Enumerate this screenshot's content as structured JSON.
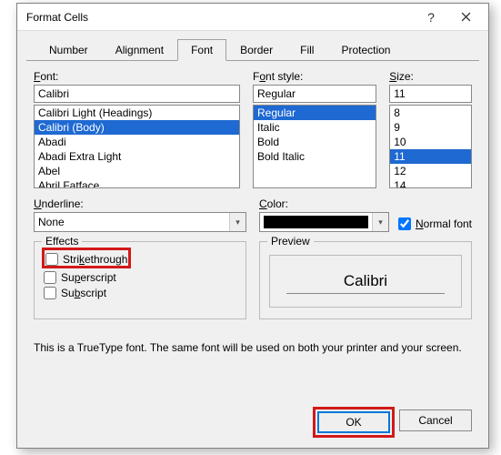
{
  "window": {
    "title": "Format Cells"
  },
  "tabs": {
    "items": [
      "Number",
      "Alignment",
      "Font",
      "Border",
      "Fill",
      "Protection"
    ],
    "active": 2
  },
  "font": {
    "label": "Font:",
    "label_u": "F",
    "value": "Calibri",
    "list": [
      "Calibri Light (Headings)",
      "Calibri (Body)",
      "Abadi",
      "Abadi Extra Light",
      "Abel",
      "Abril Fatface"
    ],
    "selected": 1
  },
  "style": {
    "label": "Font style:",
    "label_u": "o",
    "value": "Regular",
    "list": [
      "Regular",
      "Italic",
      "Bold",
      "Bold Italic"
    ],
    "selected": 0
  },
  "size": {
    "label": "Size:",
    "label_u": "S",
    "value": "11",
    "list": [
      "8",
      "9",
      "10",
      "11",
      "12",
      "14"
    ],
    "selected": 3
  },
  "underline": {
    "label": "Underline:",
    "label_u": "U",
    "value": "None"
  },
  "color": {
    "label": "Color:",
    "label_u": "C",
    "value_hex": "#000000"
  },
  "normal_font": {
    "label": "Normal font",
    "label_u": "N",
    "checked": true
  },
  "effects": {
    "legend": "Effects",
    "strike": {
      "label": "Strikethrough",
      "label_u": "k",
      "checked": false
    },
    "super": {
      "label": "Superscript",
      "label_u": "p",
      "checked": false
    },
    "sub": {
      "label": "Subscript",
      "label_u": "b",
      "checked": false
    }
  },
  "preview": {
    "legend": "Preview",
    "sample": "Calibri"
  },
  "note": "This is a TrueType font.  The same font will be used on both your printer and your screen.",
  "buttons": {
    "ok": "OK",
    "cancel": "Cancel"
  }
}
